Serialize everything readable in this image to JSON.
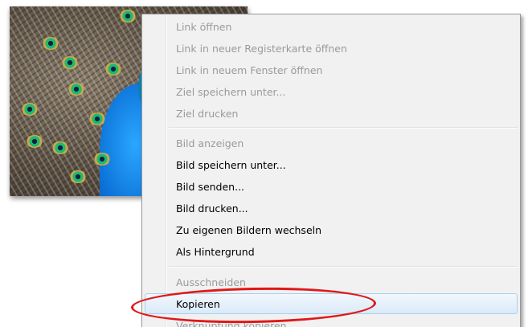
{
  "menu": {
    "items": [
      {
        "label": "Link öffnen",
        "enabled": false
      },
      {
        "label": "Link in neuer Registerkarte öffnen",
        "enabled": false
      },
      {
        "label": "Link in neuem Fenster öffnen",
        "enabled": false
      },
      {
        "label": "Ziel speichern unter...",
        "enabled": false
      },
      {
        "label": "Ziel drucken",
        "enabled": false
      },
      {
        "label": "Bild anzeigen",
        "enabled": false
      },
      {
        "label": "Bild speichern unter...",
        "enabled": true
      },
      {
        "label": "Bild senden...",
        "enabled": true
      },
      {
        "label": "Bild drucken...",
        "enabled": true
      },
      {
        "label": "Zu eigenen Bildern wechseln",
        "enabled": true
      },
      {
        "label": "Als Hintergrund",
        "enabled": true
      },
      {
        "label": "Ausschneiden",
        "enabled": false
      },
      {
        "label": "Kopieren",
        "enabled": true,
        "highlighted": true
      },
      {
        "label": "Verknüpfung kopieren",
        "enabled": false
      }
    ]
  },
  "colors": {
    "annotation": "#e01818",
    "hover_border": "#a8d1ef",
    "disabled_text": "#9a9a9a"
  }
}
